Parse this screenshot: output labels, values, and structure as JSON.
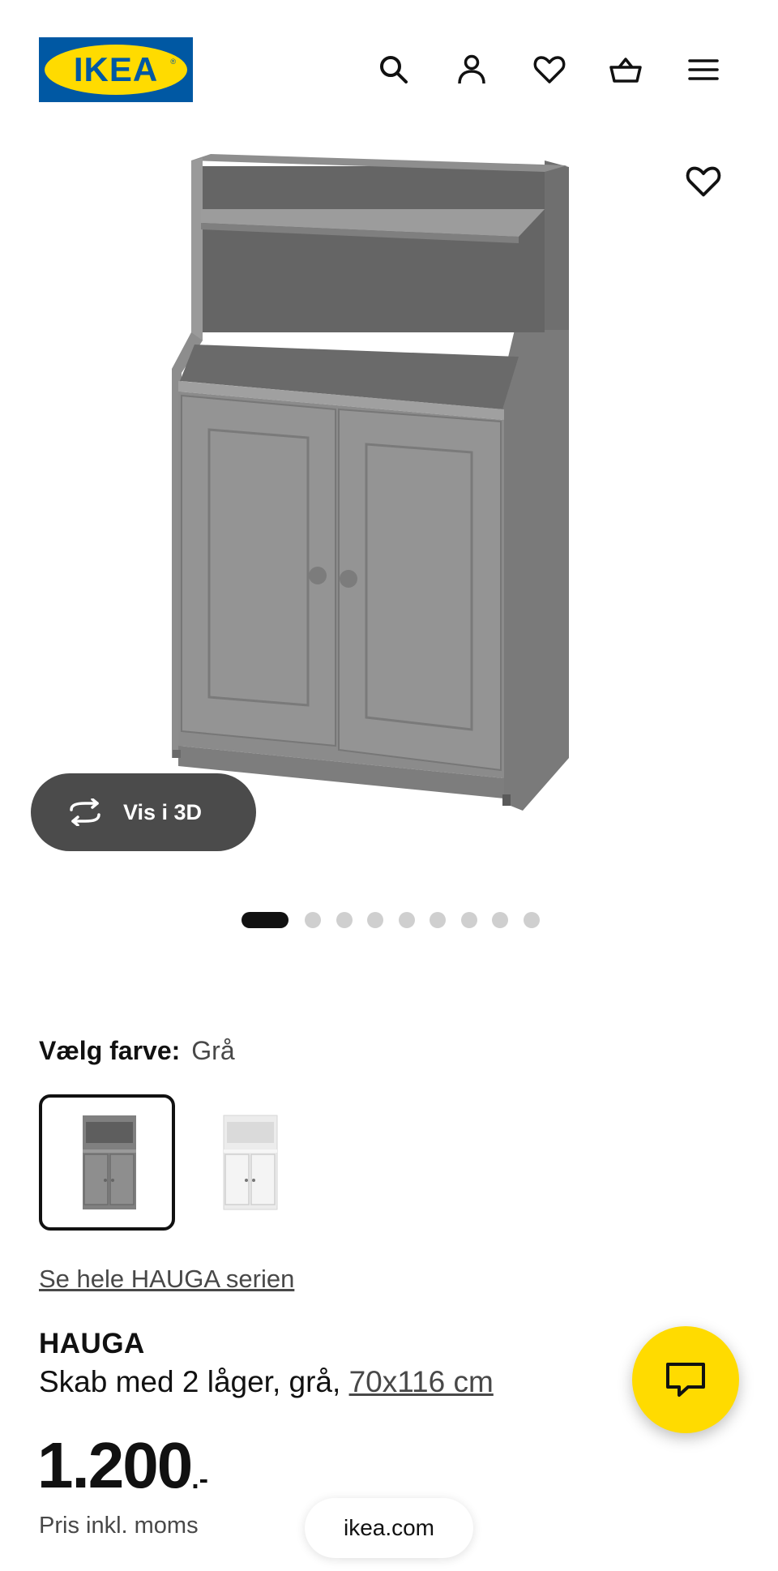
{
  "header": {
    "logo_text": "IKEA",
    "icons": [
      "search-icon",
      "account-icon",
      "heart-icon",
      "basket-icon",
      "menu-icon"
    ]
  },
  "colors": {
    "ikea_blue": "#0058A3",
    "ikea_yellow": "#FFDB00",
    "cabinet_grey": "#8a8a8a",
    "pill_dark": "#4b4b4b"
  },
  "gallery": {
    "view_3d_label": "Vis i 3D",
    "total_images": 10,
    "active_index": 0
  },
  "color_picker": {
    "label": "Vælg farve:",
    "selected_value": "Grå",
    "options": [
      "grey",
      "white"
    ]
  },
  "series_link": "Se hele HAUGA serien",
  "product": {
    "name": "HAUGA",
    "description": "Skab med 2 låger, grå, ",
    "size_link": "70x116 cm",
    "price_amount": "1.200",
    "price_suffix": ".-",
    "price_note": "Pris inkl. moms"
  },
  "browser": {
    "url": "ikea.com"
  }
}
